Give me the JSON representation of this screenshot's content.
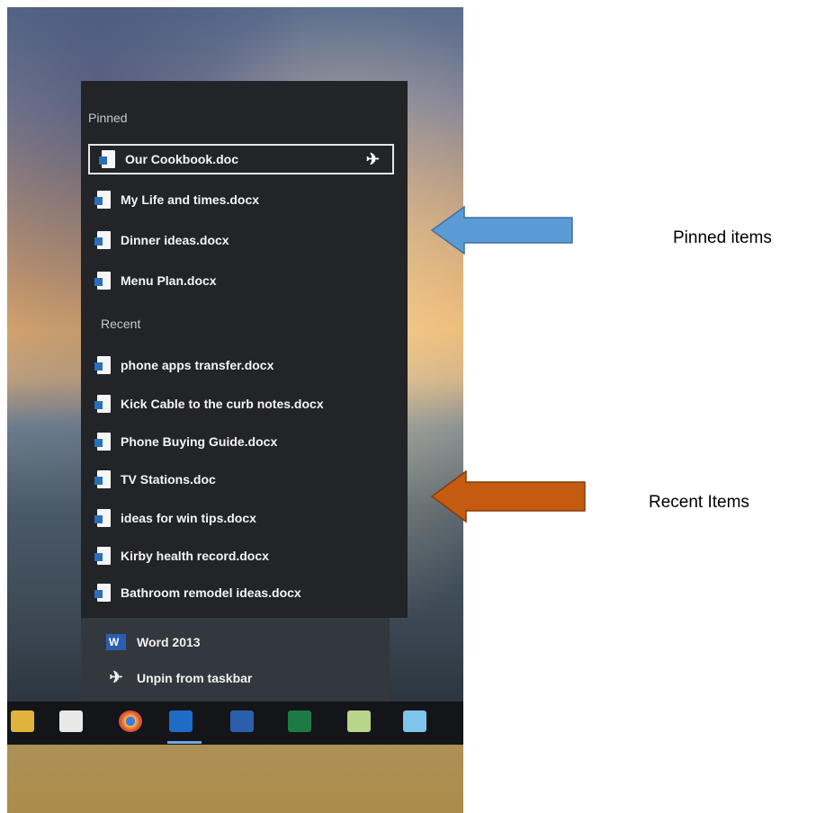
{
  "jumplist": {
    "pinned_label": "Pinned",
    "recent_label": "Recent",
    "pinned_items": [
      "Our Cookbook.doc",
      "My Life and times.docx",
      "Dinner ideas.docx",
      "Menu Plan.docx"
    ],
    "recent_items": [
      "phone apps transfer.docx",
      "Kick Cable to the curb notes.docx",
      "Phone Buying Guide.docx",
      "TV Stations.doc",
      "ideas for win tips.docx",
      "Kirby health record.docx",
      "Bathroom remodel ideas.docx"
    ],
    "app_name": "Word 2013",
    "unpin_label": "Unpin from taskbar"
  },
  "annotations": {
    "pinned": "Pinned items",
    "recent": "Recent Items",
    "pinned_arrow_color": "#5b9bd5",
    "recent_arrow_color": "#c55a11"
  },
  "taskbar": {
    "icons": [
      "file-explorer-icon",
      "store-icon",
      "chrome-icon",
      "outlook-icon",
      "word-icon",
      "excel-icon",
      "app-icon",
      "calculator-icon"
    ]
  }
}
